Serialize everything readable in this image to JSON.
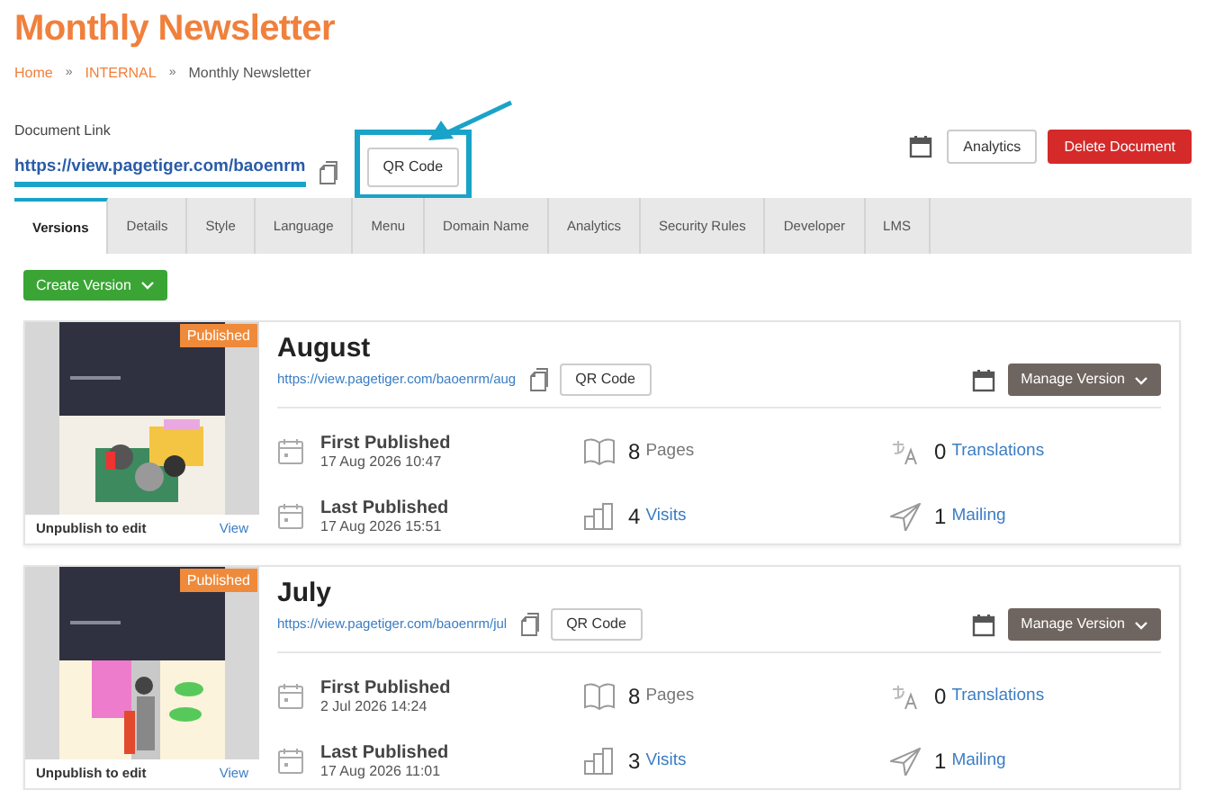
{
  "title": "Monthly Newsletter",
  "breadcrumb": [
    {
      "label": "Home",
      "link": true
    },
    {
      "label": "INTERNAL",
      "link": true
    },
    {
      "label": "Monthly Newsletter",
      "link": false
    }
  ],
  "breadcrumb_separator": "»",
  "document_link": {
    "label": "Document Link",
    "url": "https://view.pagetiger.com/baoenrm",
    "highlighted": true
  },
  "qr_button": {
    "label": "QR Code",
    "highlighted": true
  },
  "actions": [
    {
      "label": "Analytics",
      "kind": "outline"
    },
    {
      "label": "Delete Document",
      "kind": "danger"
    }
  ],
  "tabs": [
    {
      "label": "Versions",
      "selected": true
    },
    {
      "label": "Details",
      "selected": false
    },
    {
      "label": "Style",
      "selected": false
    },
    {
      "label": "Language",
      "selected": false
    },
    {
      "label": "Menu",
      "selected": false
    },
    {
      "label": "Domain Name",
      "selected": false
    },
    {
      "label": "Analytics",
      "selected": false
    },
    {
      "label": "Security Rules",
      "selected": false
    },
    {
      "label": "Developer",
      "selected": false
    },
    {
      "label": "LMS",
      "selected": false
    }
  ],
  "create_button": "Create Version",
  "versions": [
    {
      "title": "August",
      "url": "https://view.pagetiger.com/baoenrm/aug",
      "status": "Published",
      "qr_label": "QR Code",
      "manage_label": "Manage Version",
      "footer_note": "Unpublish to edit",
      "footer_link": "View",
      "dates": [
        {
          "label": "First Published",
          "value": "17 Aug 2026 10:47"
        },
        {
          "label": "Last Published",
          "value": "17 Aug 2026 15:51"
        }
      ],
      "stats": [
        {
          "kind": "pages",
          "count": "8",
          "label": "Pages",
          "link": false
        },
        {
          "kind": "translations",
          "count": "0",
          "label": "Translations",
          "link": true
        },
        {
          "kind": "visits",
          "count": "4",
          "label": "Visits",
          "link": true
        },
        {
          "kind": "mailing",
          "count": "1",
          "label": "Mailing",
          "link": true
        }
      ]
    },
    {
      "title": "July",
      "url": "https://view.pagetiger.com/baoenrm/jul",
      "status": "Published",
      "qr_label": "QR Code",
      "manage_label": "Manage Version",
      "footer_note": "Unpublish to edit",
      "footer_link": "View",
      "dates": [
        {
          "label": "First Published",
          "value": "2 Jul 2026 14:24"
        },
        {
          "label": "Last Published",
          "value": "17 Aug 2026 11:01"
        }
      ],
      "stats": [
        {
          "kind": "pages",
          "count": "8",
          "label": "Pages",
          "link": false
        },
        {
          "kind": "translations",
          "count": "0",
          "label": "Translations",
          "link": true
        },
        {
          "kind": "visits",
          "count": "3",
          "label": "Visits",
          "link": true
        },
        {
          "kind": "mailing",
          "count": "1",
          "label": "Mailing",
          "link": true
        }
      ]
    }
  ]
}
